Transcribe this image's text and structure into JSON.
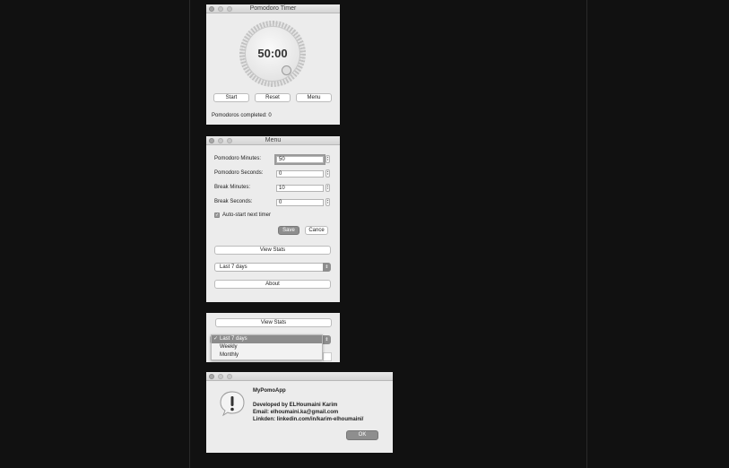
{
  "pomodoro_window": {
    "title": "Pomodoro Timer",
    "time": "50:00",
    "start_label": "Start",
    "reset_label": "Reset",
    "menu_label": "Menu",
    "completed_text": "Pomodoros completed: 0"
  },
  "menu_window": {
    "title": "Menu",
    "pomodoro_minutes_label": "Pomodoro Minutes:",
    "pomodoro_minutes_value": "50",
    "pomodoro_seconds_label": "Pomodoro Seconds:",
    "pomodoro_seconds_value": "0",
    "break_minutes_label": "Break Minutes:",
    "break_minutes_value": "10",
    "break_seconds_label": "Break Seconds:",
    "break_seconds_value": "0",
    "autostart_label": "Auto-start next timer",
    "autostart_checked": true,
    "save_label": "Save",
    "cancel_label": "Cance",
    "view_stats_label": "View Stats",
    "period_selected": "Last 7 days",
    "about_label": "About"
  },
  "stats_dropdown": {
    "view_stats_label": "View Stats",
    "options": [
      "Last 7 days",
      "Weekly",
      "Monthly"
    ],
    "selected_index": 0
  },
  "about_dialog": {
    "app_name": "MyPomoApp",
    "developer": "Developed by ELHoumaini Karim",
    "email": "Email: elhoumaini.ka@gmail.com",
    "linkedin": "Linkden: linkedin.com/in/karim-elhoumaini/",
    "ok_label": "OK"
  },
  "icons": {
    "alert": "alert-icon",
    "checkmark": "checkmark-icon"
  }
}
